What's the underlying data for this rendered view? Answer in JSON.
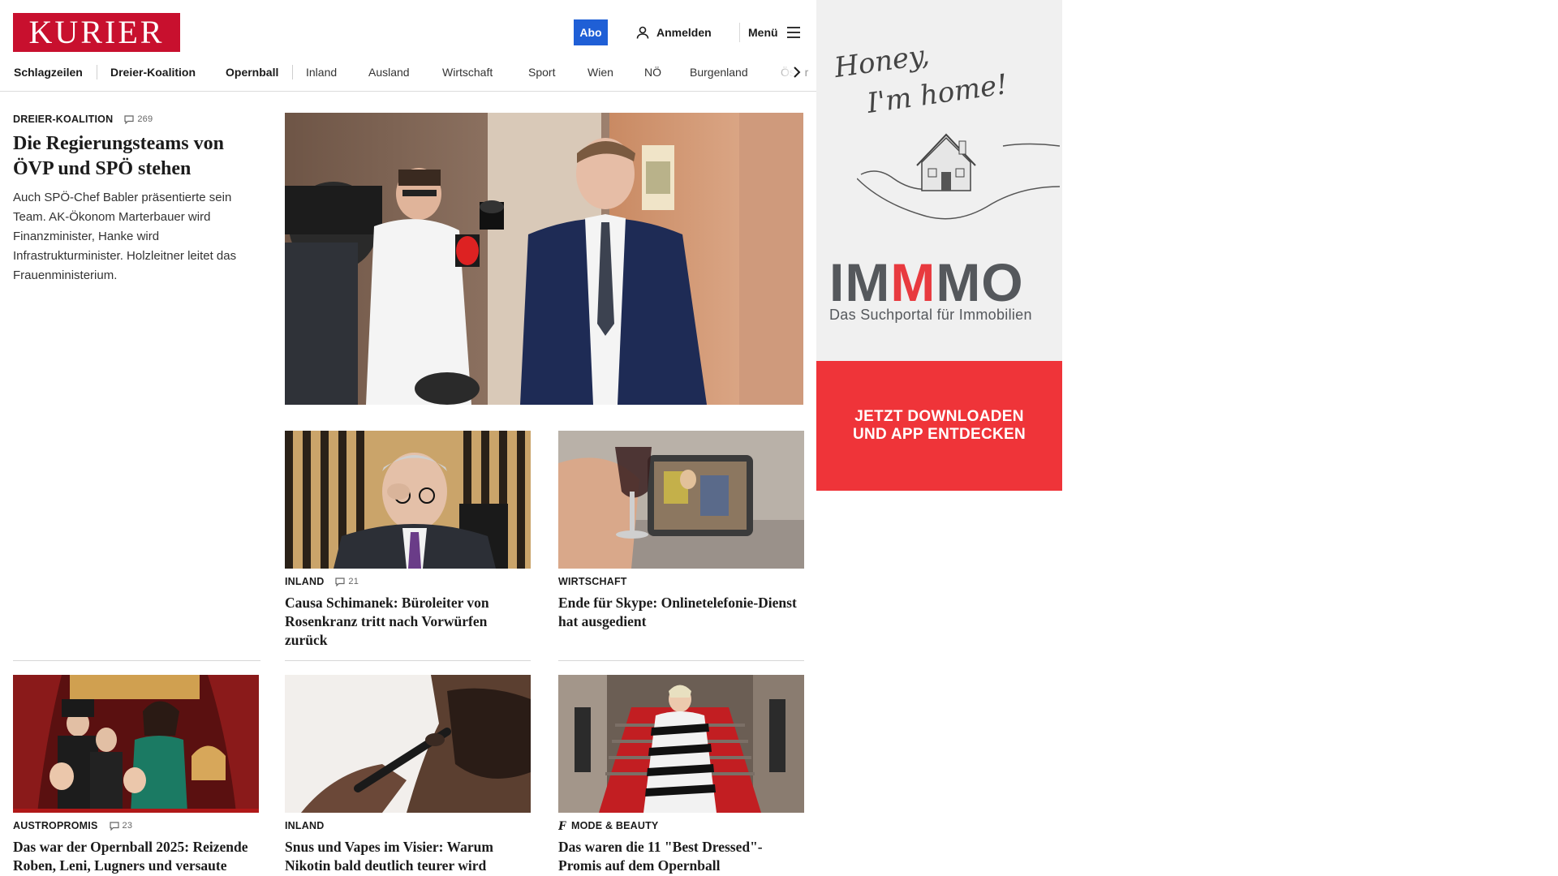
{
  "header": {
    "logo_text": "KURIER",
    "abo_label": "Abo",
    "login_label": "Anmelden",
    "menu_label": "Menü",
    "brand_color": "#c8102e",
    "abo_color": "#1f5fd6"
  },
  "nav": {
    "items": [
      "Schlagzeilen",
      "Dreier-Koalition",
      "Opernball",
      "Inland",
      "Ausland",
      "Wirtschaft",
      "Sport",
      "Wien",
      "NÖ",
      "Burgenland",
      "Öster"
    ]
  },
  "lead": {
    "kicker": "DREIER-KOALITION",
    "comments": "269",
    "headline": "Die Regierungsteams von ÖVP und SPÖ stehen",
    "summary": "Auch SPÖ-Chef Babler präsentierte sein Team. AK-Ökonom Marterbauer wird Finanzminister, Hanke wird Infrastrukturminister. Holzleitner leitet das Frauenministerium."
  },
  "teasers": [
    {
      "kicker": "INLAND",
      "comments": "21",
      "headline": "Causa Schimanek: Büroleiter von Rosenkranz tritt nach Vorwürfen zurück"
    },
    {
      "kicker": "WIRTSCHAFT",
      "comments": "",
      "headline": "Ende für Skype: Onlinetelefonie-Dienst hat ausgedient"
    },
    {
      "kicker": "AUSTROPROMIS",
      "comments": "23",
      "headline": "Das war der Opernball 2025: Reizende Roben, Leni, Lugners und versaute Punschkrapferl"
    },
    {
      "kicker": "INLAND",
      "comments": "",
      "headline": "Snus und Vapes im Visier: Warum Nikotin bald deutlich teurer wird"
    },
    {
      "kicker": "MODE & BEAUTY",
      "comments": "",
      "headline": "Das waren die 11 \"Best Dressed\"-Promis auf dem Opernball"
    }
  ],
  "ad": {
    "script_line1": "Honey,",
    "script_line2": "I'm home!",
    "brand_part1": "IM",
    "brand_part2": "M",
    "brand_part3": "MO",
    "tagline": "Das Suchportal für Immobilien",
    "cta_line1": "JETZT DOWNLOADEN",
    "cta_line2": "UND APP ENTDECKEN",
    "accent_color": "#ef3439"
  }
}
